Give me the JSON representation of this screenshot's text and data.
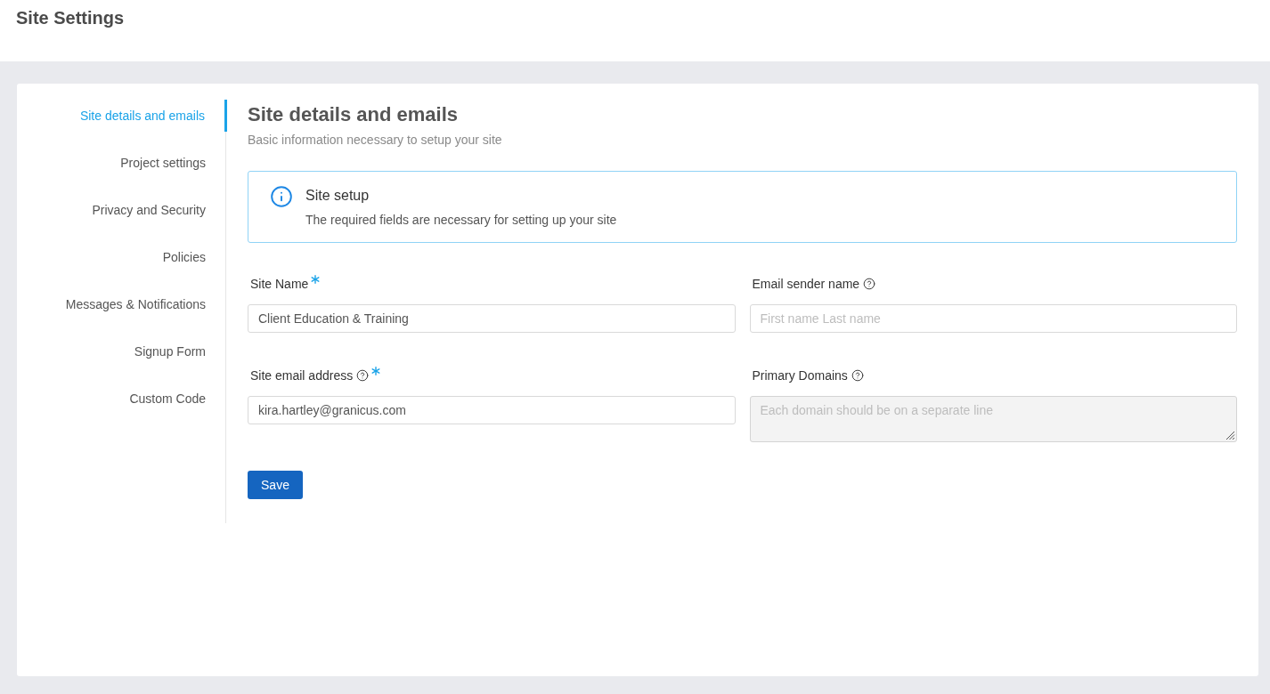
{
  "header": {
    "title": "Site Settings"
  },
  "sidebar": {
    "items": [
      {
        "label": "Site details and emails",
        "selected": true
      },
      {
        "label": "Project settings",
        "selected": false
      },
      {
        "label": "Privacy and Security",
        "selected": false
      },
      {
        "label": "Policies",
        "selected": false
      },
      {
        "label": "Messages & Notifications",
        "selected": false
      },
      {
        "label": "Signup Form",
        "selected": false
      },
      {
        "label": "Custom Code",
        "selected": false
      }
    ]
  },
  "section": {
    "title": "Site details and emails",
    "subtitle": "Basic information necessary to setup your site"
  },
  "notice": {
    "title": "Site setup",
    "text": "The required fields are necessary for setting up your site"
  },
  "form": {
    "fields": [
      {
        "kind": "input",
        "label": "Site Name",
        "required": true,
        "help": false,
        "value": "Client Education & Training",
        "disabled": false
      },
      {
        "kind": "input",
        "label": "Email sender name",
        "required": false,
        "help": true,
        "placeholder": "First name Last name",
        "disabled": false
      },
      {
        "kind": "input",
        "label": "Site email address",
        "required": true,
        "help": true,
        "value": "kira.hartley@granicus.com",
        "disabled": false
      },
      {
        "kind": "textarea",
        "label": "Primary Domains",
        "required": false,
        "help": true,
        "placeholder": "Each domain should be on a separate line",
        "disabled": true
      }
    ],
    "save_button": "Save"
  }
}
